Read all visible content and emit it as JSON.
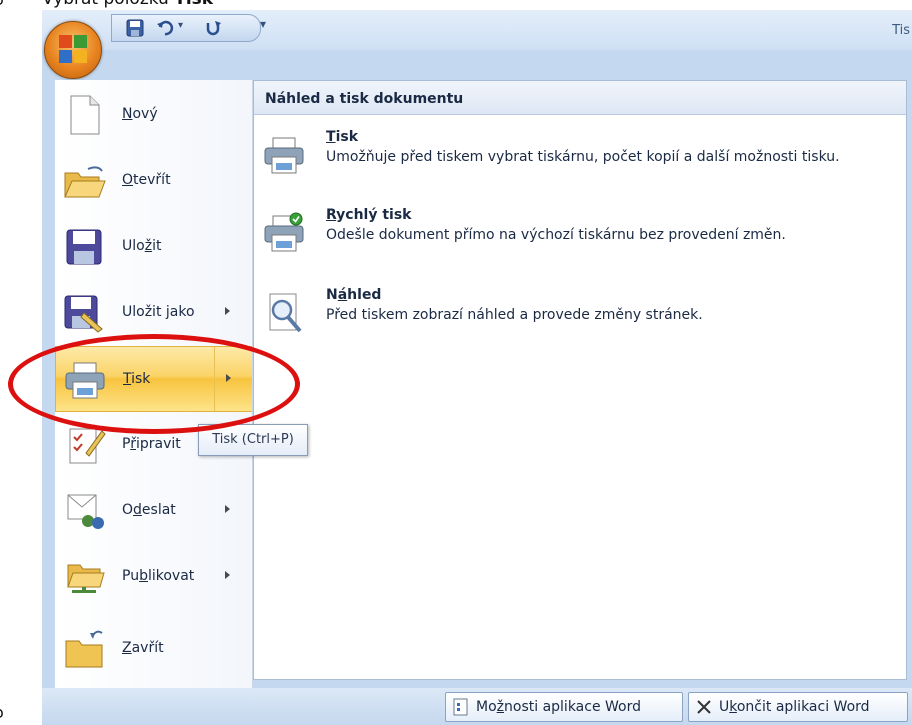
{
  "instruction": {
    "bullet": "o",
    "prefix": "Vybrat položku ",
    "bold": "Tisk"
  },
  "bottom_bullet": "o",
  "window": {
    "title": "Tis"
  },
  "qat": {
    "more": "▾"
  },
  "menu": {
    "items": [
      {
        "label_pre": "",
        "label_u": "N",
        "label_post": "ový"
      },
      {
        "label_pre": "",
        "label_u": "O",
        "label_post": "tevřít"
      },
      {
        "label_pre": "Ulo",
        "label_u": "ž",
        "label_post": "it"
      },
      {
        "label_pre": "Uložit ",
        "label_u": "j",
        "label_post": "ako"
      },
      {
        "label_pre": "",
        "label_u": "T",
        "label_post": "isk"
      },
      {
        "label_pre": "P",
        "label_u": "ř",
        "label_post": "ipravit"
      },
      {
        "label_pre": "O",
        "label_u": "d",
        "label_post": "eslat"
      },
      {
        "label_pre": "Pu",
        "label_u": "b",
        "label_post": "likovat"
      },
      {
        "label_pre": "",
        "label_u": "Z",
        "label_post": "avřít"
      }
    ]
  },
  "panel": {
    "title": "Náhled a tisk dokumentu",
    "items": [
      {
        "title_pre": "",
        "title_u": "T",
        "title_post": "isk",
        "desc": "Umožňuje před tiskem vybrat tiskárnu, počet kopií a další možnosti tisku."
      },
      {
        "title_pre": "",
        "title_u": "R",
        "title_post": "ychlý tisk",
        "desc": "Odešle dokument přímo na výchozí tiskárnu bez provedení změn."
      },
      {
        "title_pre": "N",
        "title_u": "á",
        "title_post": "hled",
        "desc": "Před tiskem zobrazí náhled a provede změny stránek."
      }
    ]
  },
  "tooltip": "Tisk (Ctrl+P)",
  "footer": {
    "options": {
      "pre": "Mo",
      "u": "ž",
      "post": "nosti aplikace Word"
    },
    "exit": {
      "pre": "U",
      "u": "k",
      "post": "ončit aplikaci Word"
    }
  },
  "colors": {
    "accent_red": "#dd1010",
    "highlight": "#fbd468",
    "chrome": "#c4d9ef"
  }
}
